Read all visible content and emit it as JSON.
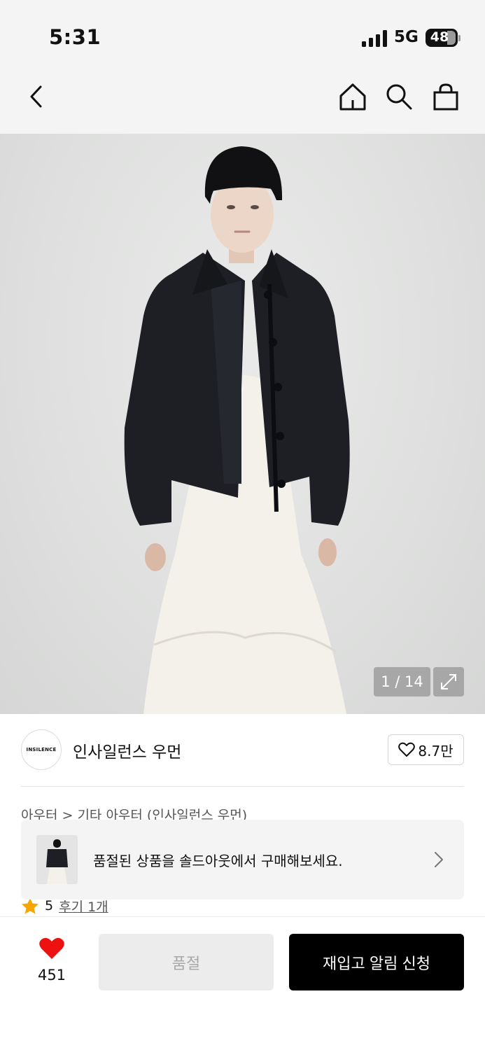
{
  "status_bar": {
    "time": "5:31",
    "network": "5G",
    "battery": "48"
  },
  "nav": {
    "back_icon": "chevron-left-icon",
    "home_icon": "home-icon",
    "search_icon": "search-icon",
    "cart_icon": "shopping-bag-icon"
  },
  "gallery": {
    "indicator": "1 / 14",
    "current": 1,
    "total": 14,
    "expand_icon": "expand-icon",
    "background": "#e2e3e2"
  },
  "brand": {
    "logo_text": "INSILENCE",
    "name": "인사일런스 우먼",
    "likes": "8.7만"
  },
  "product": {
    "breadcrumb": "아우터 > 기타 아우터 (인사일런스 우먼)",
    "rating": "5",
    "review_link": "후기 1개"
  },
  "soldout_banner": {
    "message": "품절된 상품을 솔드아웃에서 구매해보세요."
  },
  "bottom_bar": {
    "heart_count": "451",
    "soldout_label": "품절",
    "restock_label": "재입고 알림 신청",
    "heart_color": "#ee1111",
    "primary_color": "#000000"
  }
}
